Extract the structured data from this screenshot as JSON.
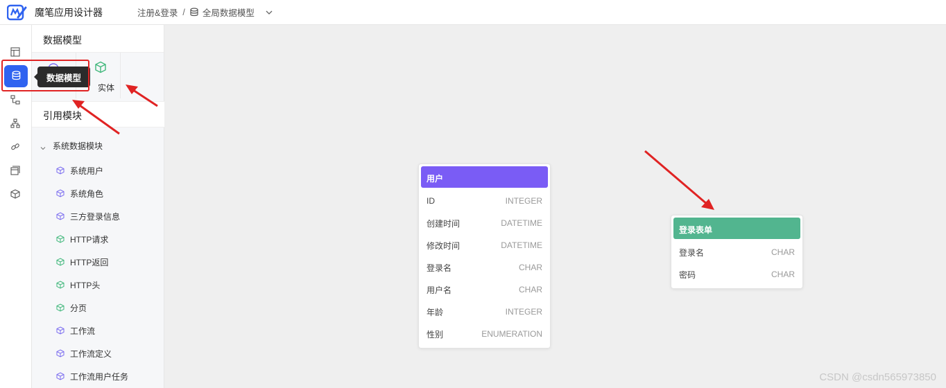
{
  "app": {
    "title": "魔笔应用设计器"
  },
  "breadcrumb": {
    "parent": "注册&登录",
    "separator": "/",
    "current": "全局数据模型"
  },
  "rail": {
    "items": [
      {
        "icon": "layout-icon"
      },
      {
        "icon": "database-icon",
        "active": true
      },
      {
        "icon": "flow-icon"
      },
      {
        "icon": "hierarchy-icon"
      },
      {
        "icon": "link-icon"
      },
      {
        "icon": "window-icon"
      },
      {
        "icon": "cube-icon"
      }
    ],
    "tooltip": "数据模型"
  },
  "panel": {
    "title": "数据模型",
    "tools": {
      "entity_label": "实体"
    },
    "modules_title": "引用模块",
    "group": {
      "label": "系统数据模块",
      "items": [
        {
          "label": "系统用户",
          "color": "#7b6cf0"
        },
        {
          "label": "系统角色",
          "color": "#7b6cf0"
        },
        {
          "label": "三方登录信息",
          "color": "#7b6cf0"
        },
        {
          "label": "HTTP请求",
          "color": "#3fb77a"
        },
        {
          "label": "HTTP返回",
          "color": "#3fb77a"
        },
        {
          "label": "HTTP头",
          "color": "#3fb77a"
        },
        {
          "label": "分页",
          "color": "#3fb77a"
        },
        {
          "label": "工作流",
          "color": "#7b6cf0"
        },
        {
          "label": "工作流定义",
          "color": "#7b6cf0"
        },
        {
          "label": "工作流用户任务",
          "color": "#7b6cf0"
        }
      ]
    }
  },
  "entities": {
    "user": {
      "title": "用户",
      "color": "#7a5cf5",
      "fields": [
        {
          "name": "ID",
          "type": "INTEGER"
        },
        {
          "name": "创建时间",
          "type": "DATETIME"
        },
        {
          "name": "修改时间",
          "type": "DATETIME"
        },
        {
          "name": "登录名",
          "type": "CHAR"
        },
        {
          "name": "用户名",
          "type": "CHAR"
        },
        {
          "name": "年龄",
          "type": "INTEGER"
        },
        {
          "name": "性别",
          "type": "ENUMERATION"
        }
      ]
    },
    "login_form": {
      "title": "登录表单",
      "color": "#52b58f",
      "fields": [
        {
          "name": "登录名",
          "type": "CHAR"
        },
        {
          "name": "密码",
          "type": "CHAR"
        }
      ]
    }
  },
  "watermark": "CSDN @csdn565973850"
}
